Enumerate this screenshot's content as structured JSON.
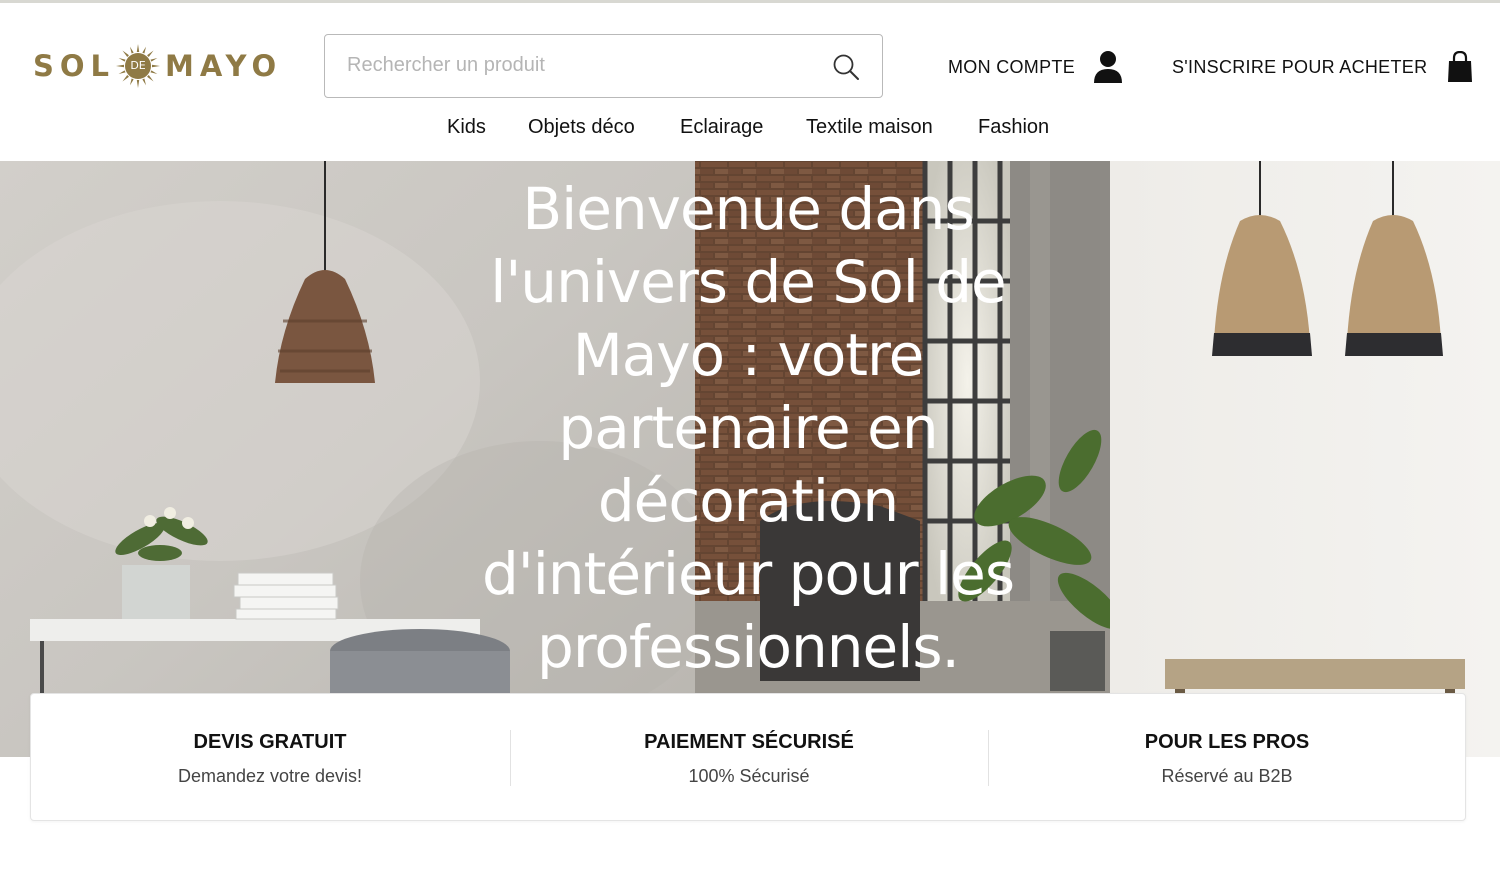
{
  "header": {
    "logo": {
      "word_left": "SOL",
      "word_middle": "DE",
      "word_right": "MAYO"
    },
    "search": {
      "placeholder": "Rechercher un produit",
      "icon": "search-icon"
    },
    "account": {
      "label": "MON COMPTE",
      "icon": "user-icon"
    },
    "signup": {
      "label": "S'INSCRIRE POUR ACHETER",
      "icon": "shopping-bag-icon"
    },
    "brand_color": "#8f7a45"
  },
  "nav": {
    "items": [
      {
        "label": "Kids"
      },
      {
        "label": "Objets déco"
      },
      {
        "label": "Eclairage"
      },
      {
        "label": "Textile maison"
      },
      {
        "label": "Fashion"
      }
    ]
  },
  "hero": {
    "title_lines": [
      "Bienvenue dans",
      "l'univers de Sol de",
      "Mayo : votre",
      "partenaire en",
      "décoration",
      "d'intérieur pour les",
      "professionnels."
    ]
  },
  "features": [
    {
      "title": "DEVIS GRATUIT",
      "subtitle": "Demandez votre devis!"
    },
    {
      "title": "PAIEMENT SÉCURISÉ",
      "subtitle": "100% Sécurisé"
    },
    {
      "title": "POUR LES PROS",
      "subtitle": "Réservé au B2B"
    }
  ]
}
